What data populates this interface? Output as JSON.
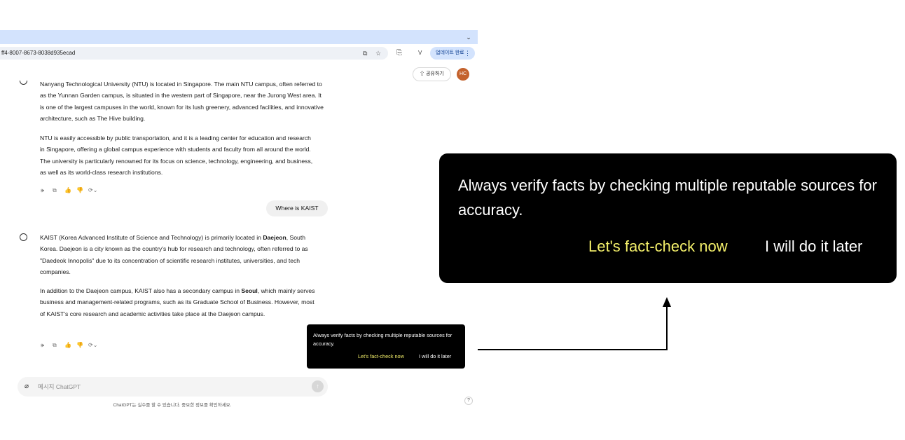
{
  "browser": {
    "url": "ff4-8007-8673-8038d935ecad",
    "update_button": "업데이트 완료",
    "update_menu": "⋮",
    "tab_menu": "⌄",
    "toolbar_icons": {
      "translate": "⧉",
      "star": "☆",
      "extensions": "⎘",
      "menu_letter": "V"
    }
  },
  "header": {
    "share_label": "⇧ 공유하기",
    "avatar_initials": "HC"
  },
  "chat": {
    "assistant_1_top": "Nanyang Technological University (NTU) is located in Singapore. The main NTU campus, often referred to as the Yunnan Garden campus, is situated in the western part of Singapore, near the Jurong West area. It is one of the largest campuses in the world, known for its lush greenery, advanced facilities, and innovative architecture, such as The Hive building.",
    "assistant_1_para2": "NTU is easily accessible by public transportation, and it is a leading center for education and research in Singapore, offering a global campus experience with students and faculty from all around the world. The university is particularly renowned for its focus on science, technology, engineering, and business, as well as its world-class research institutions.",
    "user_message": "Where is KAIST",
    "assistant_2_intro": "KAIST (Korea Advanced Institute of Science and Technology) is primarily located in ",
    "assistant_2_bold1": "Daejeon",
    "assistant_2_rest": ", South Korea. Daejeon is a city known as the country's hub for research and technology, often referred to as \"Daedeok Innopolis\" due to its concentration of scientific research institutes, universities, and tech companies.",
    "assistant_2_p2_intro": "In addition to the Daejeon campus, KAIST also has a secondary campus in ",
    "assistant_2_p2_bold": "Seoul",
    "assistant_2_p2_rest": ", which mainly serves business and management-related programs, such as its Graduate School of Business. However, most of KAIST's core research and academic activities take place at the Daejeon campus.",
    "action_icons": {
      "speak": "🕪",
      "copy": "⧉",
      "like": "👍",
      "dislike": "👎",
      "regenerate": "⟳⌄"
    }
  },
  "composer": {
    "placeholder": "메시지 ChatGPT",
    "attach_icon": "⌀",
    "send_icon": "↑",
    "disclaimer": "ChatGPT는 실수를 할 수 있습니다. 중요한 정보를 확인하세요.",
    "help": "?"
  },
  "popup": {
    "message": "Always verify facts by checking multiple reputable sources for accuracy.",
    "primary_action": "Let's fact-check now",
    "secondary_action": "I will do it later",
    "primary_color": "#f3ef6a"
  }
}
